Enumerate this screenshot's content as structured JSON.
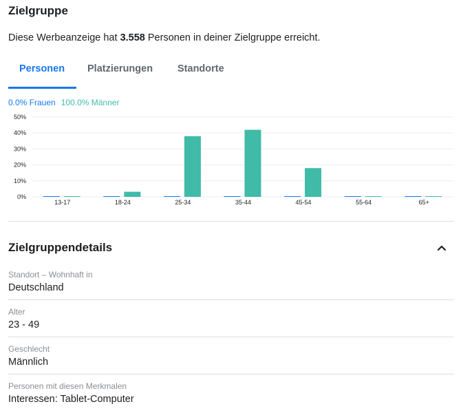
{
  "header": {
    "title": "Zielgruppe",
    "reach_prefix": "Diese Werbeanzeige hat ",
    "reach_count": "3.558",
    "reach_suffix": " Personen in deiner Zielgruppe erreicht."
  },
  "tabs": [
    {
      "label": "Personen",
      "active": true
    },
    {
      "label": "Platzierungen",
      "active": false
    },
    {
      "label": "Standorte",
      "active": false
    }
  ],
  "legend": {
    "women": "0.0% Frauen",
    "men": "100.0% Männer"
  },
  "colors": {
    "women": "#1877f2",
    "men": "#3fbba8",
    "accent": "#1877f2"
  },
  "chart_data": {
    "type": "bar",
    "categories": [
      "13-17",
      "18-24",
      "25-34",
      "35-44",
      "45-54",
      "55-64",
      "65+"
    ],
    "series": [
      {
        "name": "Frauen",
        "values": [
          0,
          0,
          0,
          0,
          0,
          0,
          0
        ]
      },
      {
        "name": "Männer",
        "values": [
          0,
          3.2,
          38,
          42,
          18,
          0,
          0
        ]
      }
    ],
    "yticks": [
      "50%",
      "40%",
      "30%",
      "20%",
      "10%",
      "0%"
    ],
    "ylim": [
      0,
      50
    ],
    "grid": true
  },
  "details": {
    "title": "Zielgruppendetails",
    "collapse_icon": "chevron-up-icon",
    "items": [
      {
        "label": "Standort – Wohnhaft in",
        "value": "Deutschland"
      },
      {
        "label": "Alter",
        "value": "23 - 49"
      },
      {
        "label": "Geschlecht",
        "value": "Männlich"
      },
      {
        "label": "Personen mit diesen Merkmalen",
        "value": "Interessen: Tablet-Computer"
      }
    ]
  }
}
